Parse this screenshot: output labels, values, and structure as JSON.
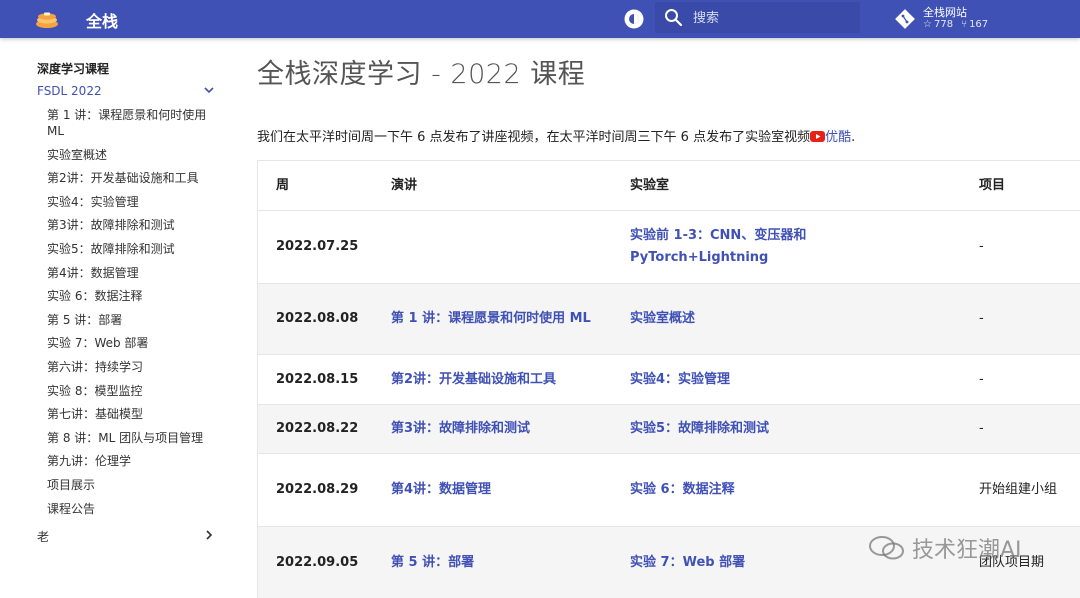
{
  "header": {
    "site_title": "全栈",
    "search_placeholder": "搜索",
    "repo": {
      "name": "全栈网站",
      "stars": "778",
      "forks": "167"
    },
    "colors": {
      "primary": "#4051b5"
    }
  },
  "sidebar": {
    "section_title": "深度学习课程",
    "active_group": "FSDL 2022",
    "items": [
      "第 1 讲：课程愿景和何时使用 ML",
      "实验室概述",
      "第2讲：开发基础设施和工具",
      "实验4：实验管理",
      "第3讲：故障排除和测试",
      "实验5：故障排除和测试",
      "第4讲：数据管理",
      "实验 6：数据注释",
      "第 5 讲：部署",
      "实验 7：Web 部署",
      "第六讲：持续学习",
      "实验 8：模型监控",
      "第七讲：基础模型",
      "第 8 讲：ML 团队与项目管理",
      "第九讲：伦理学",
      "项目展示",
      "课程公告"
    ],
    "collapsed_group": "老"
  },
  "main": {
    "title": "全栈深度学习 - 2022 课程",
    "intro_text": "我们在太平洋时间周一下午 6 点发布了讲座视频，在太平洋时间周三下午 6 点发布了实验室视频",
    "intro_link": "优酷",
    "intro_end": ".",
    "table": {
      "headers": [
        "周",
        "演讲",
        "实验室",
        "项目"
      ],
      "rows": [
        {
          "week": "2022.07.25",
          "lecture": "",
          "lab": "实验前 1-3：CNN、变压器和 PyTorch+Lightning",
          "project": "-"
        },
        {
          "week": "2022.08.08",
          "lecture": "第 1 讲：课程愿景和何时使用 ML",
          "lab": "实验室概述",
          "project": "-"
        },
        {
          "week": "2022.08.15",
          "lecture": "第2讲：开发基础设施和工具",
          "lab": "实验4：实验管理",
          "project": "-"
        },
        {
          "week": "2022.08.22",
          "lecture": "第3讲：故障排除和测试",
          "lab": "实验5：故障排除和测试",
          "project": "-"
        },
        {
          "week": "2022.08.29",
          "lecture": "第4讲：数据管理",
          "lab": "实验 6：数据注释",
          "project": "开始组建小组"
        },
        {
          "week": "2022.09.05",
          "lecture": "第 5 讲：部署",
          "lab": "实验 7：Web 部署",
          "project": "团队项目期"
        }
      ]
    }
  },
  "watermark": "技术狂潮AI"
}
